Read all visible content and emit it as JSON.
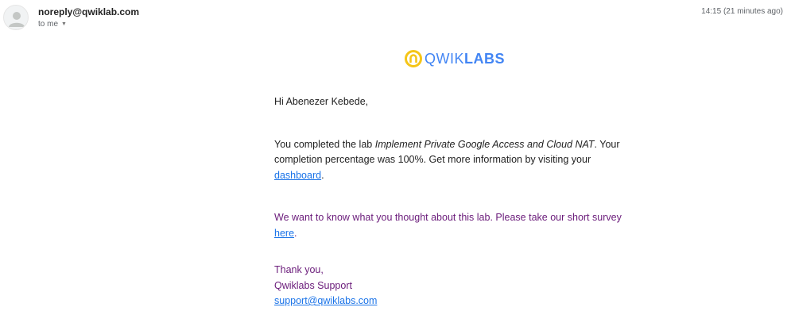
{
  "email": {
    "sender": "noreply@qwiklab.com",
    "recipient_label": "to me",
    "timestamp": "14:15 (21 minutes ago)"
  },
  "logo": {
    "light_text": "QWIK",
    "bold_text": "LABS",
    "icon": "qwiklabs-logo-icon",
    "icon_color": "#f5c518",
    "text_color": "#4285f4"
  },
  "body": {
    "greeting": "Hi Abenezer Kebede,",
    "p1_before": "You completed the lab ",
    "p1_lab_name": "Implement Private Google Access and Cloud NAT",
    "p1_after": ". Your completion percentage was 100%. Get more information by visiting your ",
    "p1_link": "dashboard",
    "p1_end": ".",
    "p2_before": "We want to know what you thought about this lab. Please take our short survey ",
    "p2_link": "here",
    "p2_end": ".",
    "sign_thanks": "Thank you,",
    "sign_team": "Qwiklabs Support",
    "sign_email": "support@qwiklabs.com"
  },
  "colors": {
    "link": "#1a73e8",
    "purple_text": "#6a1b7a"
  }
}
